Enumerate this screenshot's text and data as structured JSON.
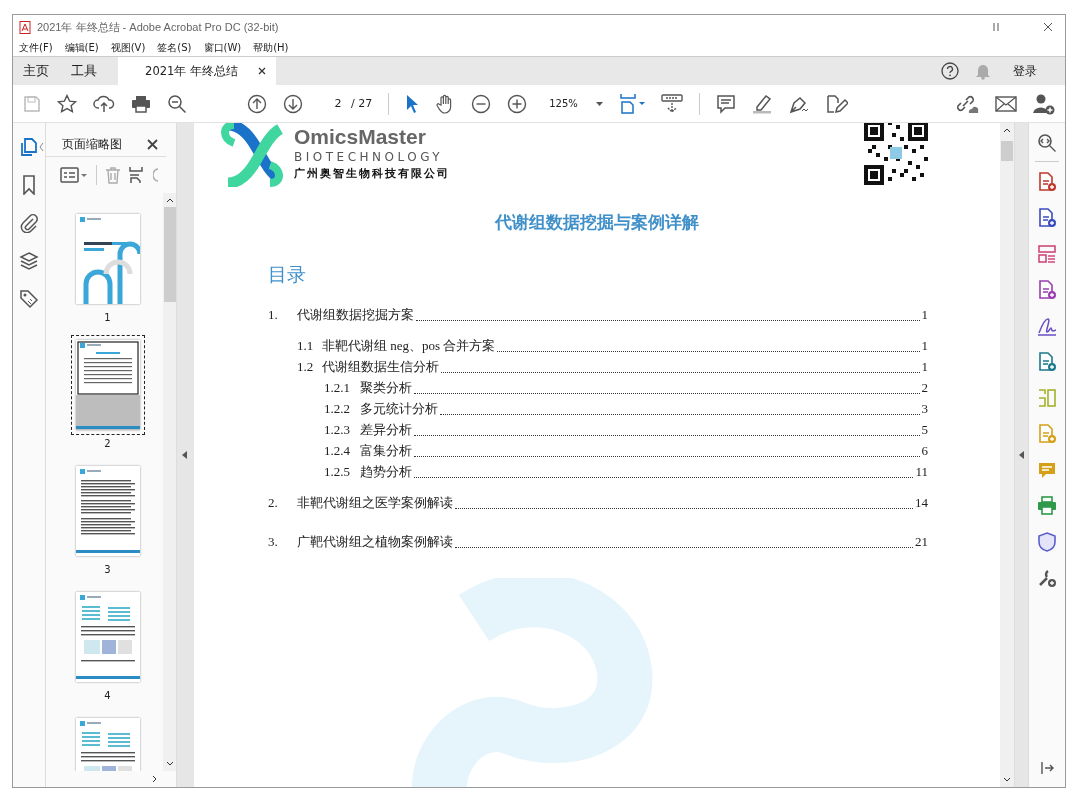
{
  "window": {
    "title": "2021年 年终总结 - Adobe Acrobat Pro DC (32-bit)"
  },
  "menu": [
    "文件(F)",
    "编辑(E)",
    "视图(V)",
    "签名(S)",
    "窗口(W)",
    "帮助(H)"
  ],
  "tabs": [
    {
      "label": "主页",
      "selected": false,
      "kind": "nav"
    },
    {
      "label": "工具",
      "selected": false,
      "kind": "nav"
    },
    {
      "label": "2021年 年终总结",
      "selected": true,
      "kind": "document"
    }
  ],
  "sign_in": "登录",
  "toolbar": {
    "page_number": "2",
    "page_count": "/ 27",
    "zoom": "125%"
  },
  "thumbnail_panel": {
    "title": "页面缩略图",
    "thumbnails": [
      {
        "label": "1",
        "selected": false,
        "kind": "cover"
      },
      {
        "label": "2",
        "selected": true,
        "kind": "contents"
      },
      {
        "label": "3",
        "selected": false,
        "kind": "text"
      },
      {
        "label": "4",
        "selected": false,
        "kind": "figures"
      },
      {
        "kind": "figures",
        "selected": false
      }
    ]
  },
  "document": {
    "brand": "OmicsMaster",
    "brand_sub": "BIOTECHNOLOGY",
    "company": "广州奥智生物科技有限公司",
    "title": "代谢组数据挖掘与案例详解",
    "toc_heading": "目录",
    "toc": [
      {
        "number": "1.",
        "title": "代谢组数据挖掘方案",
        "page": "1",
        "children": [
          {
            "number": "1.1",
            "title": "非靶代谢组 neg、pos 合并方案",
            "page": "1"
          },
          {
            "number": "1.2",
            "title": "代谢组数据生信分析",
            "page": "1",
            "children": [
              {
                "number": "1.2.1",
                "title": "聚类分析",
                "page": "2"
              },
              {
                "number": "1.2.2",
                "title": "多元统计分析",
                "page": "3"
              },
              {
                "number": "1.2.3",
                "title": "差异分析",
                "page": "5"
              },
              {
                "number": "1.2.4",
                "title": "富集分析",
                "page": "6"
              },
              {
                "number": "1.2.5",
                "title": "趋势分析",
                "page": "11"
              }
            ]
          }
        ]
      },
      {
        "number": "2.",
        "title": "非靶代谢组之医学案例解读",
        "page": "14"
      },
      {
        "number": "3.",
        "title": "广靶代谢组之植物案例解读",
        "page": "21"
      }
    ]
  }
}
